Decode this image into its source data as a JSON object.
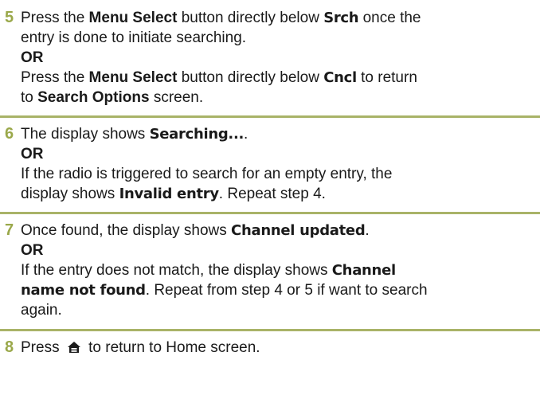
{
  "steps": [
    {
      "num": "5",
      "line1_a": "Press the ",
      "line1_b": "Menu Select",
      "line1_c": " button directly below ",
      "line1_d": "Srch",
      "line1_e": " once the",
      "line2": "entry is done to initiate searching.",
      "or": "OR",
      "line3_a": "Press the ",
      "line3_b": "Menu Select",
      "line3_c": " button directly below ",
      "line3_d": "Cncl",
      "line3_e": " to return",
      "line4_a": "to ",
      "line4_b": "Search Options",
      "line4_c": " screen."
    },
    {
      "num": "6",
      "line1_a": "The display shows ",
      "line1_b": "Searching...",
      "line1_c": ".",
      "or": "OR",
      "line2": "If the radio is triggered to search for an empty entry, the",
      "line3_a": "display shows ",
      "line3_b": "Invalid entry",
      "line3_c": ". Repeat step 4."
    },
    {
      "num": "7",
      "line1_a": "Once found, the display shows ",
      "line1_b": "Channel updated",
      "line1_c": ".",
      "or": "OR",
      "line2_a": "If the entry does not match, the display shows ",
      "line2_b": "Channel",
      "line3_a": "name not found",
      "line3_b": ". Repeat from step 4 or 5 if want to search",
      "line4": "again."
    },
    {
      "num": "8",
      "line1_a": "Press ",
      "icon": "home-icon",
      "line1_b": " to return to Home screen."
    }
  ],
  "colors": {
    "step_number": "#9aa84a",
    "rule": "#a9b368"
  }
}
